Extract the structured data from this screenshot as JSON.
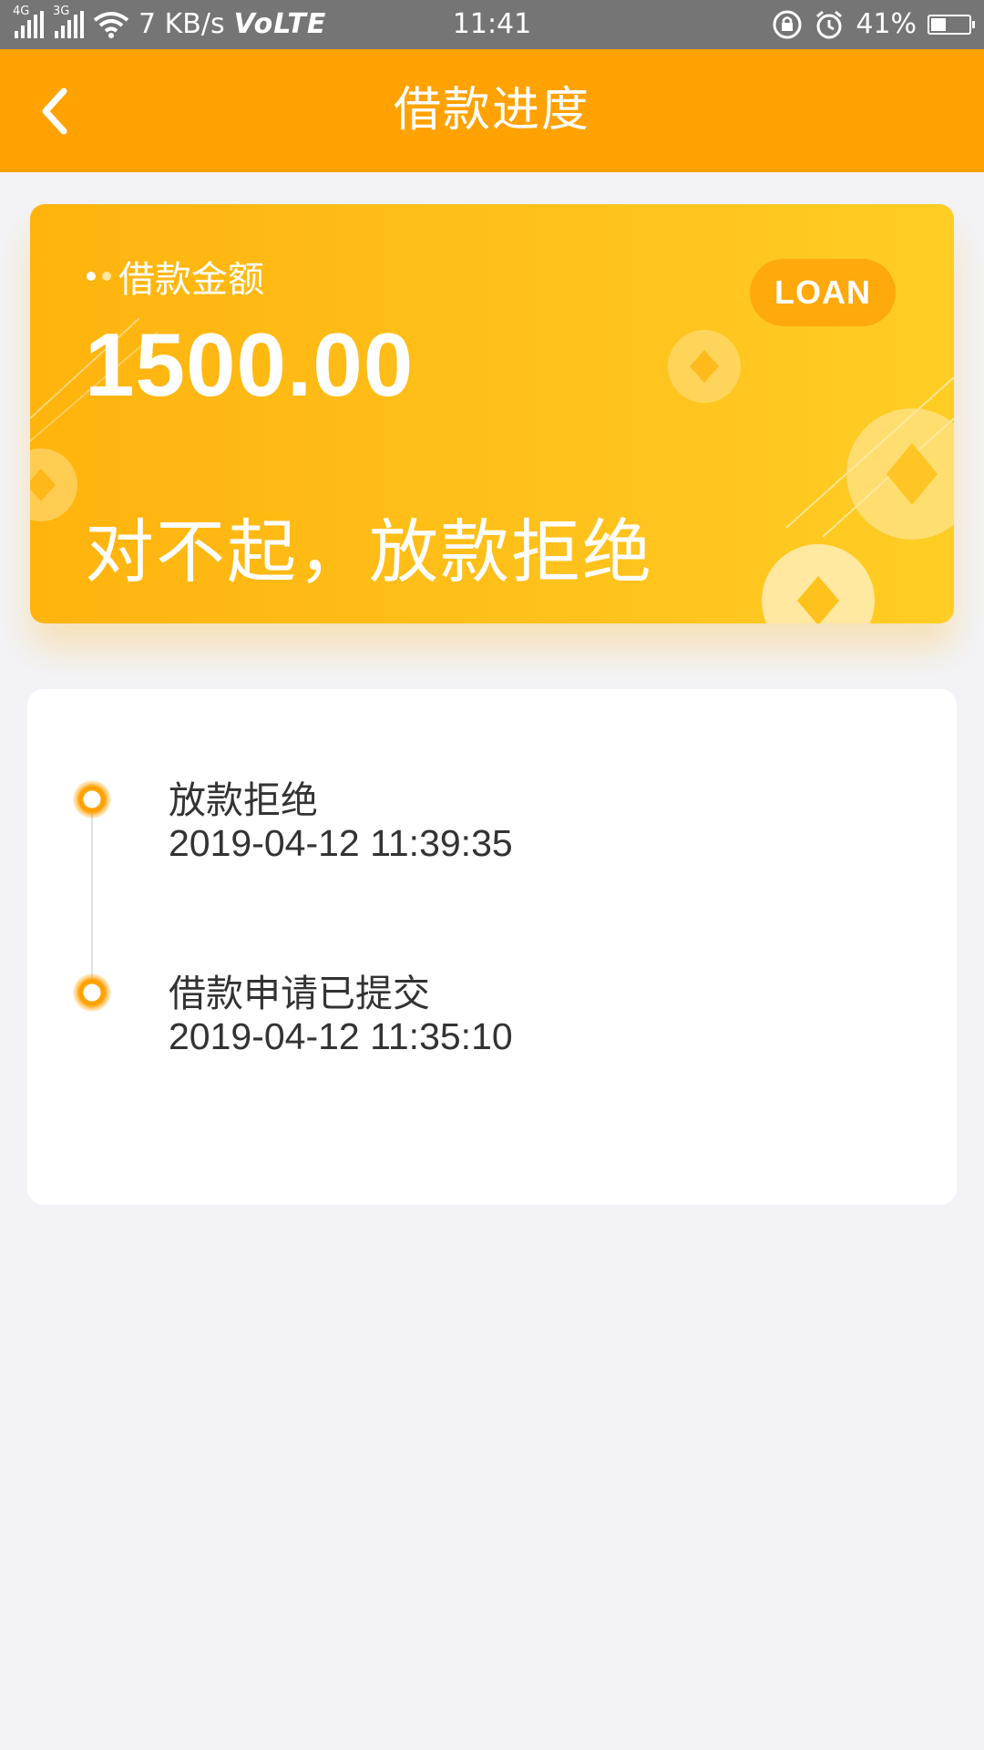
{
  "status_bar": {
    "network_1": "4G",
    "network_2": "3G",
    "speed": "7 KB/s",
    "volte": "VoLTE",
    "time": "11:41",
    "battery": "41%",
    "battery_level": 0.41
  },
  "header": {
    "title": "借款进度",
    "back_icon": "chevron-left-icon"
  },
  "card": {
    "amount_label": "借款金额",
    "amount": "1500.00",
    "badge": "LOAN",
    "status_message": "对不起，放款拒绝"
  },
  "timeline": [
    {
      "title": "放款拒绝",
      "time": "2019-04-12 11:39:35"
    },
    {
      "title": "借款申请已提交",
      "time": "2019-04-12 11:35:10"
    }
  ],
  "colors": {
    "accent": "#ffa202",
    "background": "#f3f3f7",
    "status_bar": "#757575"
  }
}
